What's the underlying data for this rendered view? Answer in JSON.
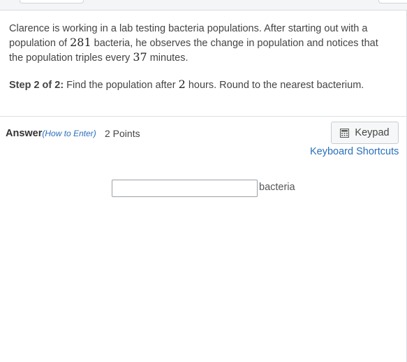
{
  "question": {
    "line1": "Clarence is working in a lab testing bacteria populations. After starting out with a",
    "line2a": "population of ",
    "initial": "281",
    "line2b": " bacteria, he observes the change in population and notices that",
    "line3a": "the population triples every ",
    "interval": "37",
    "line3b": " minutes."
  },
  "step": {
    "label": "Step 2 of 2:",
    "text_a": " Find the population after ",
    "hours": "2",
    "text_b": " hours. Round to the nearest bacterium."
  },
  "answer": {
    "label": "Answer",
    "how_to_enter": "(How to Enter)",
    "points": "2 Points",
    "keypad_label": "Keypad",
    "keyboard_shortcuts": "Keyboard Shortcuts",
    "input_value": "",
    "unit": "bacteria"
  },
  "icons": {
    "keypad": "calculator-icon"
  }
}
